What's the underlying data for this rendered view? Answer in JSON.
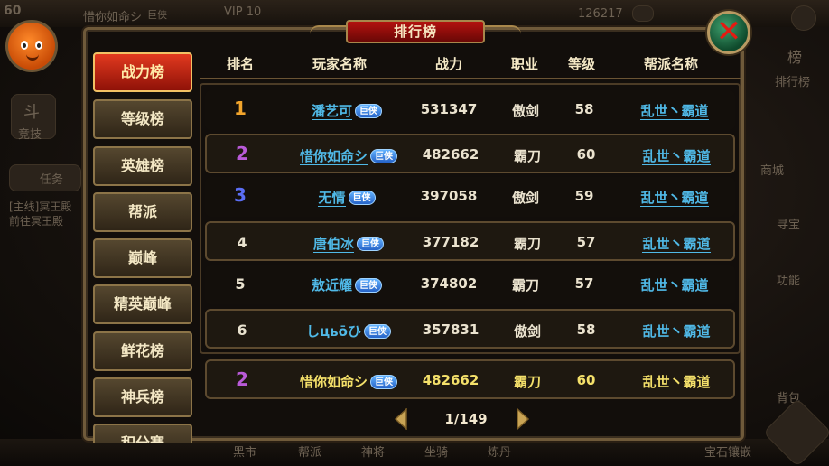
{
  "background": {
    "level": "60",
    "top_name": "惜你如命シ",
    "top_badge": "巨侠",
    "vip": "VIP 10",
    "gold": "126217",
    "left_hud": [
      "斗",
      "竞技",
      "任务"
    ],
    "quest_line1": "[主线]冥王殿",
    "quest_line2": "前往冥王殿",
    "right_hud": [
      "榜",
      "排行榜",
      "商城",
      "寻宝",
      "功能",
      "背包"
    ],
    "bottom_hud": [
      "黑市",
      "帮派",
      "神将",
      "坐骑",
      "炼丹",
      "宝石镶嵌"
    ]
  },
  "dialog": {
    "title": "排行榜",
    "close_label": "✕"
  },
  "tabs": [
    {
      "label": "战力榜",
      "active": true
    },
    {
      "label": "等级榜",
      "active": false
    },
    {
      "label": "英雄榜",
      "active": false
    },
    {
      "label": "帮派",
      "active": false
    },
    {
      "label": "巅峰",
      "active": false
    },
    {
      "label": "精英巅峰",
      "active": false
    },
    {
      "label": "鲜花榜",
      "active": false
    },
    {
      "label": "神兵榜",
      "active": false
    },
    {
      "label": "积分赛",
      "active": false
    }
  ],
  "table": {
    "headers": {
      "rank": "排名",
      "player": "玩家名称",
      "power": "战力",
      "job": "职业",
      "level": "等级",
      "guild": "帮派名称"
    },
    "rows": [
      {
        "rank": "1",
        "name": "潘艺可",
        "badge": "巨侠",
        "power": "531347",
        "job": "傲剑",
        "level": "58",
        "guild": "乱世丶霸道"
      },
      {
        "rank": "2",
        "name": "惜你如命シ",
        "badge": "巨侠",
        "power": "482662",
        "job": "霸刀",
        "level": "60",
        "guild": "乱世丶霸道"
      },
      {
        "rank": "3",
        "name": "无情",
        "badge": "巨侠",
        "power": "397058",
        "job": "傲剑",
        "level": "59",
        "guild": "乱世丶霸道"
      },
      {
        "rank": "4",
        "name": "唐伯冰",
        "badge": "巨侠",
        "power": "377182",
        "job": "霸刀",
        "level": "57",
        "guild": "乱世丶霸道"
      },
      {
        "rank": "5",
        "name": "敖近耀",
        "badge": "巨侠",
        "power": "374802",
        "job": "霸刀",
        "level": "57",
        "guild": "乱世丶霸道"
      },
      {
        "rank": "6",
        "name": "しцьōひ",
        "badge": "巨侠",
        "power": "357831",
        "job": "傲剑",
        "level": "58",
        "guild": "乱世丶霸道"
      }
    ],
    "self_row": {
      "rank": "2",
      "name": "惜你如命シ",
      "badge": "巨侠",
      "power": "482662",
      "job": "霸刀",
      "level": "60",
      "guild": "乱世丶霸道"
    }
  },
  "pager": {
    "text": "1/149"
  },
  "colors": {
    "accent_red": "#b3120f",
    "link_blue": "#50b9e7",
    "gold": "#f4e06a",
    "frame": "#6f5a3a"
  }
}
